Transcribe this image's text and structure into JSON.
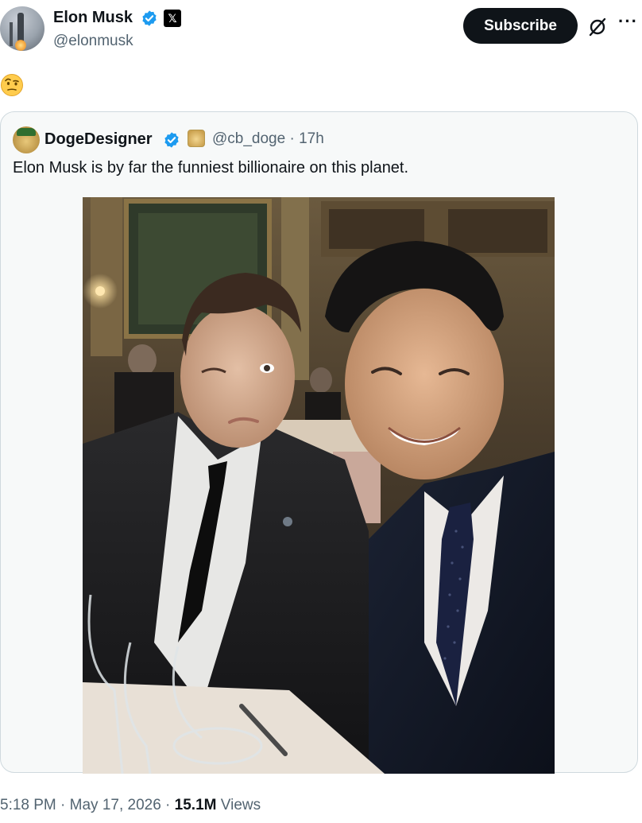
{
  "author": {
    "name": "Elon Musk",
    "handle": "@elonmusk",
    "avatar_icon": "starship-avatar",
    "badge_icon": "x-affiliation-icon"
  },
  "header": {
    "subscribe_label": "Subscribe",
    "grok_icon": "grok-icon",
    "more_icon": "more-icon",
    "more_label": "···"
  },
  "post": {
    "emoji": "face-with-raised-eyebrow-emoji"
  },
  "quote": {
    "name": "DogeDesigner",
    "handle_time": "@cb_doge · 17h",
    "text": "Elon Musk is by far the funniest billionaire on this planet.",
    "avatar_icon": "doge-avatar",
    "badge_icon": "doge-badge-icon"
  },
  "footer": {
    "time_date": "5:18 PM · May 17, 2026 · ",
    "views_count": "15.1M",
    "views_label": " Views"
  },
  "colors": {
    "verified": "#1d9bf0",
    "text_secondary": "#536471",
    "text_primary": "#0f1419",
    "border": "#cfd9de"
  }
}
